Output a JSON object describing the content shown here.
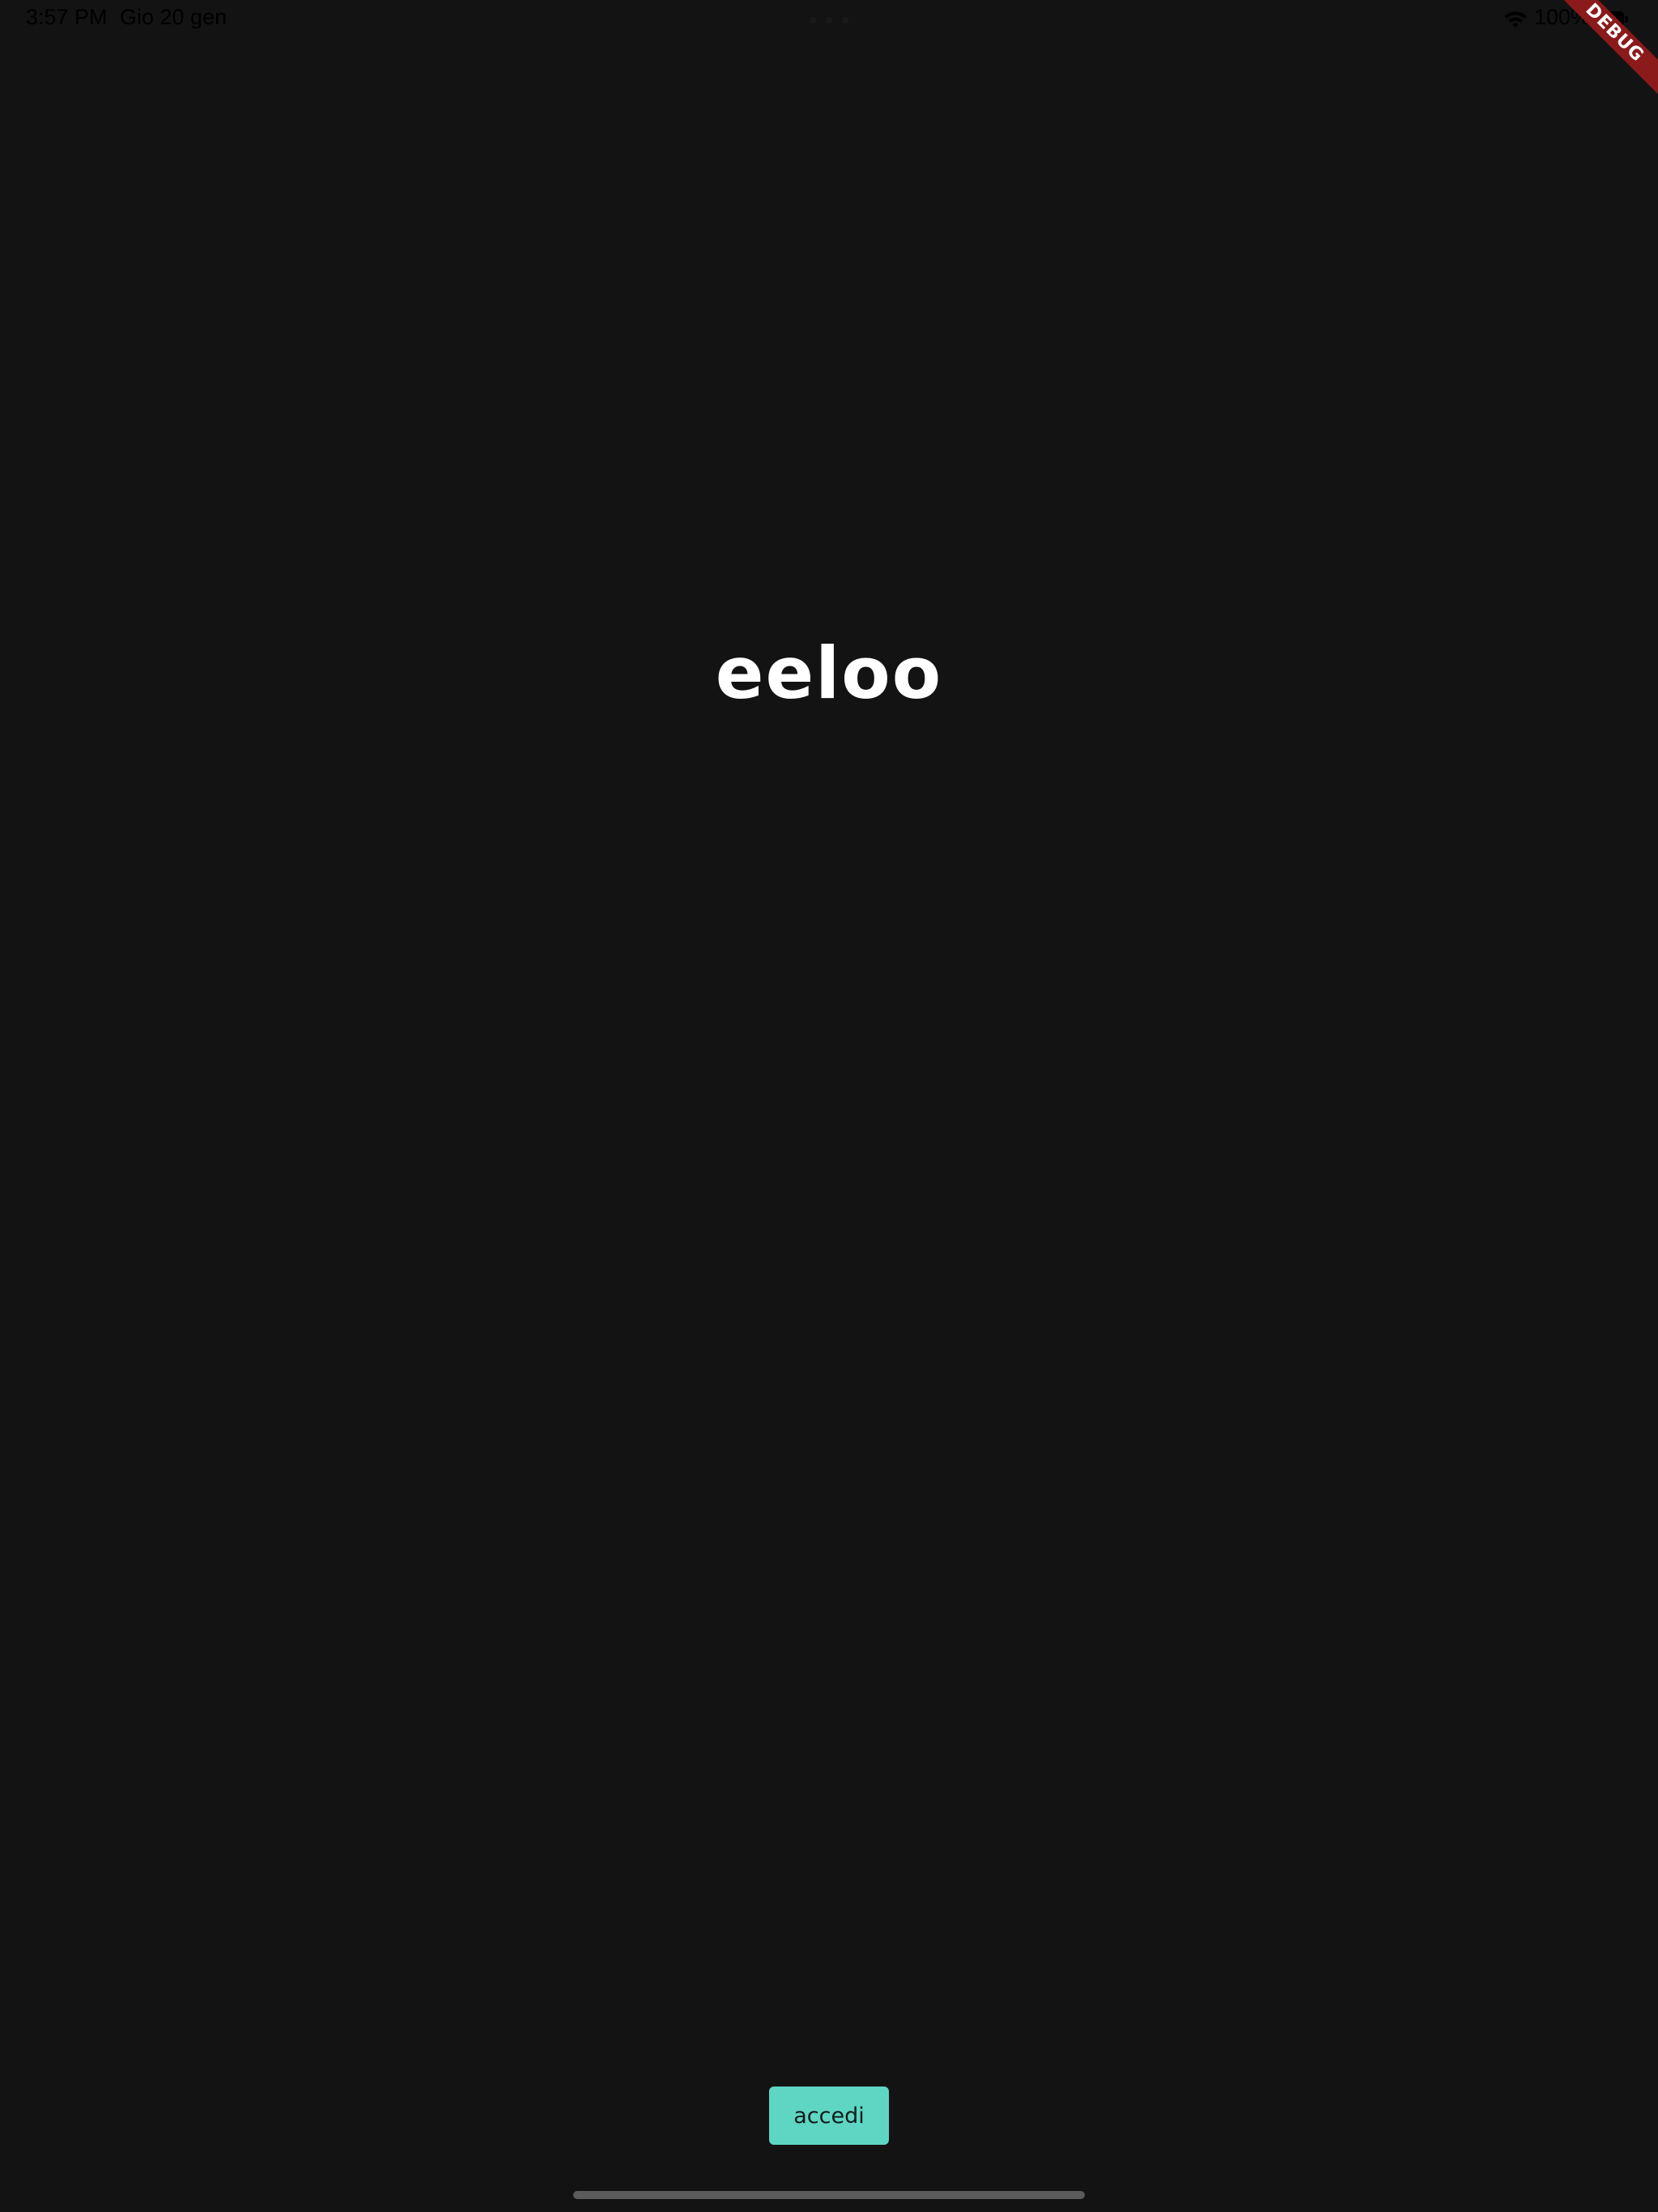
{
  "status_bar": {
    "time": "3:57 PM",
    "date": "Gio 20 gen",
    "battery_percent": "100%",
    "wifi_icon": "wifi-icon",
    "battery_icon": "battery-icon"
  },
  "debug_banner": {
    "label": "DEBUG",
    "color": "#8b1a1a"
  },
  "main": {
    "title": "eeloo"
  },
  "login_button": {
    "label": "accedi",
    "color": "#5fd6c4"
  },
  "colors": {
    "background": "#131313",
    "title": "#ffffff"
  }
}
